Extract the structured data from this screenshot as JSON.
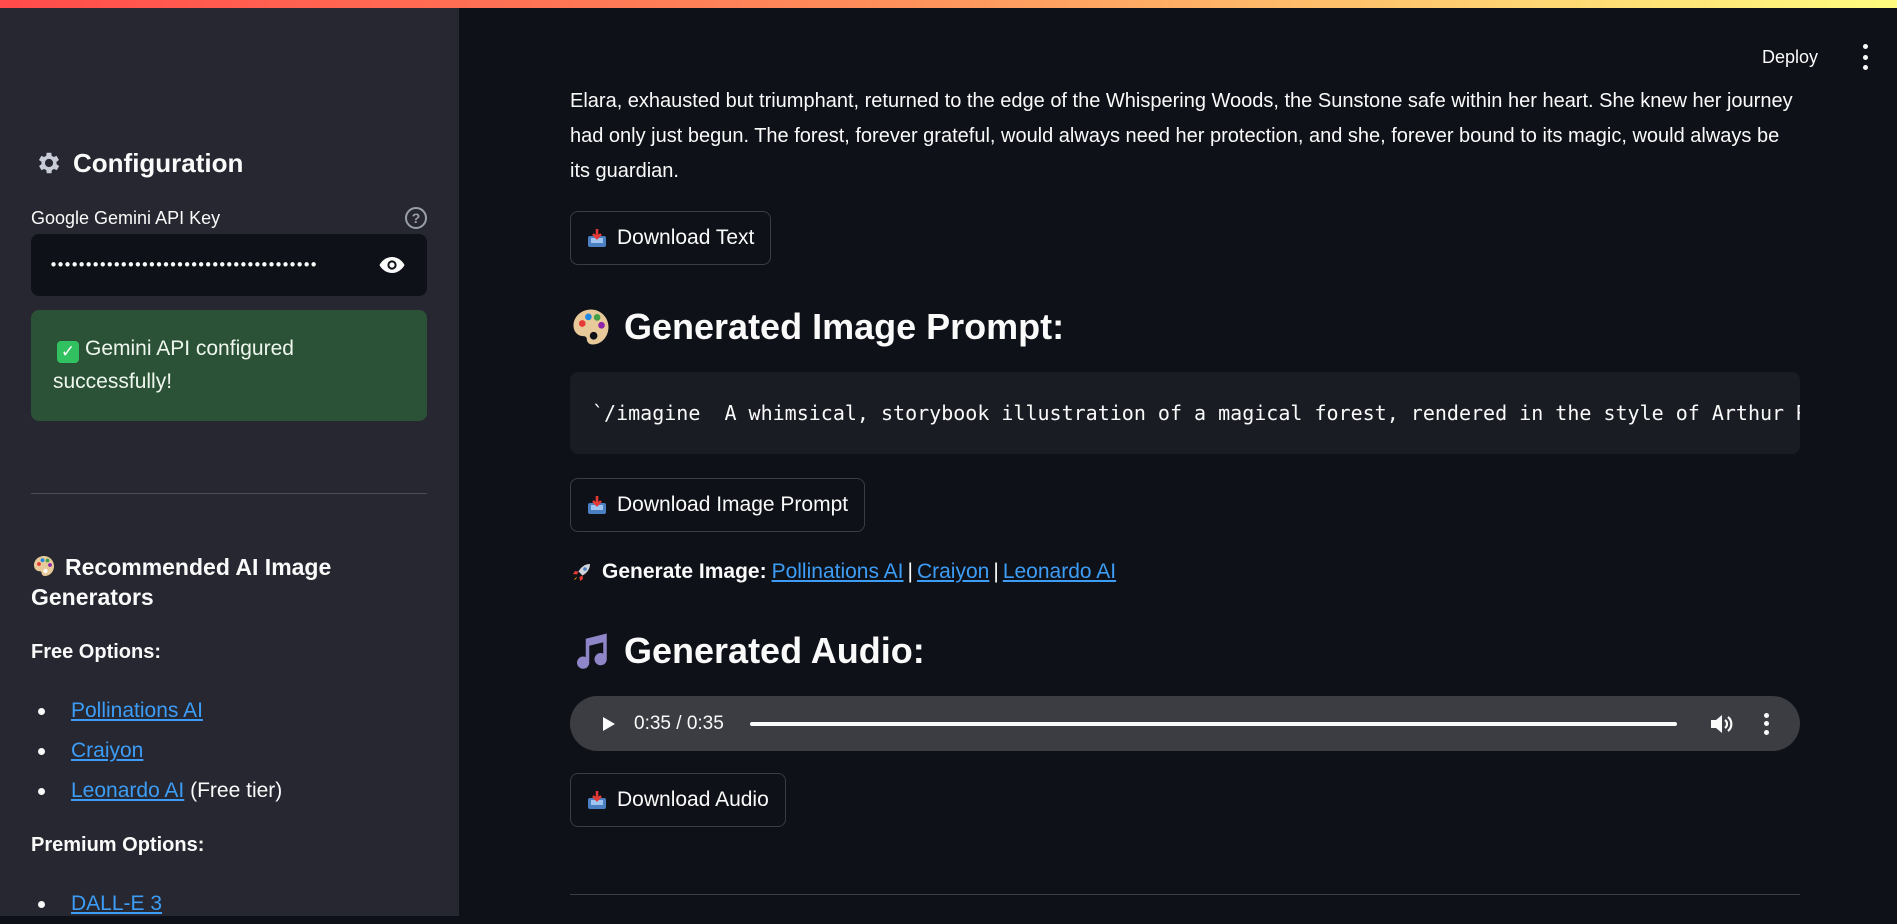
{
  "header": {
    "deploy_label": "Deploy"
  },
  "sidebar": {
    "config_title": "Configuration",
    "api_key_label": "Google Gemini API Key",
    "api_key_value": "••••••••••••••••••••••••••••••••••••••",
    "success_message": "Gemini API configured successfully!",
    "recommended_title": "Recommended AI Image Generators",
    "free_options_label": "Free Options:",
    "free_options": [
      {
        "label": "Pollinations AI",
        "suffix": ""
      },
      {
        "label": "Craiyon",
        "suffix": ""
      },
      {
        "label": "Leonardo AI",
        "suffix": "(Free tier)"
      }
    ],
    "premium_options_label": "Premium Options:",
    "premium_options": [
      {
        "label": "DALL-E 3"
      }
    ]
  },
  "main": {
    "story_text": "Elara, exhausted but triumphant, returned to the edge of the Whispering Woods, the Sunstone safe within her heart. She knew her journey had only just begun. The forest, forever grateful, would always need her protection, and she, forever bound to its magic, would always be its guardian.",
    "download_text_label": "Download Text",
    "image_prompt_heading": "Generated Image Prompt:",
    "image_prompt_code": "`/imagine  A whimsical, storybook illustration of a magical forest, rendered in the style of Arthur Rackh",
    "download_prompt_label": "Download Image Prompt",
    "generate_image_label": "Generate Image:",
    "generate_links": [
      "Pollinations AI",
      "Craiyon",
      "Leonardo AI"
    ],
    "audio_heading": "Generated Audio:",
    "audio_time": "0:35 / 0:35",
    "audio_progress": 1.0,
    "download_audio_label": "Download Audio"
  },
  "colors": {
    "accent_link": "#3d9df6",
    "success_bg": "#2b5237",
    "sidebar_bg": "#262730",
    "main_bg": "#0e1117"
  }
}
